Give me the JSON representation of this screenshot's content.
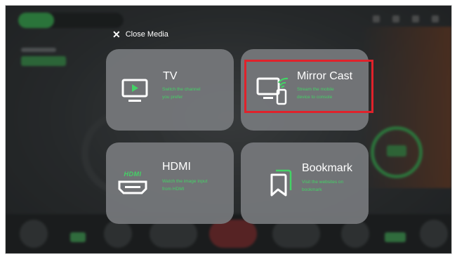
{
  "close_media": {
    "label": "Close Media",
    "icon": "close-icon"
  },
  "cards": {
    "tv": {
      "title": "TV",
      "desc_1": "Switch the channel",
      "desc_2": "you prefer",
      "icon": "tv-play-icon"
    },
    "mirror_cast": {
      "title": "Mirror Cast",
      "desc_1": "Stream the mobile",
      "desc_2": "device to console",
      "icon": "mirror-cast-icon"
    },
    "hdmi": {
      "title": "HDMI",
      "badge": "HDMI",
      "desc_1": "Watch the image input",
      "desc_2": "from HDMI",
      "icon": "hdmi-icon"
    },
    "bookmark": {
      "title": "Bookmark",
      "desc_1": "Visit the websites on",
      "desc_2": "bookmark",
      "icon": "bookmark-icon"
    }
  },
  "colors": {
    "accent_green": "#44d266",
    "highlight_red": "#e0222b",
    "card_bg": "#76797c"
  }
}
